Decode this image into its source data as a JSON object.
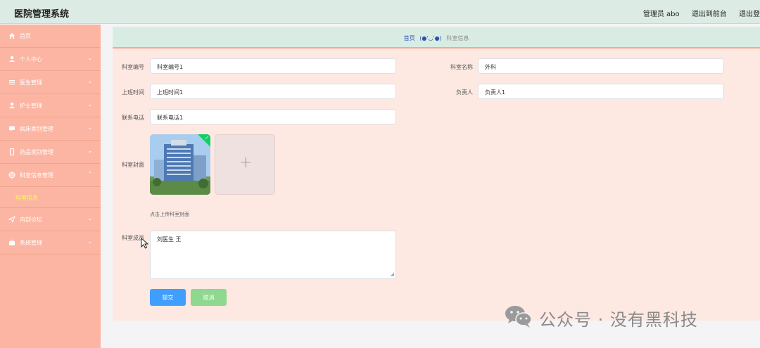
{
  "header": {
    "title": "医院管理系统",
    "admin": "管理员 abo",
    "back_to_front": "退出到前台",
    "logout": "退出登"
  },
  "sidebar": {
    "items": [
      {
        "label": "首页",
        "icon": "home-icon",
        "has_chevron": false
      },
      {
        "label": "个人中心",
        "icon": "user-icon",
        "has_chevron": true
      },
      {
        "label": "医生管理",
        "icon": "list-icon",
        "has_chevron": true
      },
      {
        "label": "护士管理",
        "icon": "user-icon",
        "has_chevron": true
      },
      {
        "label": "病床类别管理",
        "icon": "chat-icon",
        "has_chevron": true
      },
      {
        "label": "药品类别管理",
        "icon": "phone-icon",
        "has_chevron": true
      },
      {
        "label": "科室信息管理",
        "icon": "globe-icon",
        "has_chevron": true,
        "expanded": true
      }
    ],
    "active_sub": "科室信息",
    "items_after": [
      {
        "label": "内部论坛",
        "icon": "send-icon",
        "has_chevron": true
      },
      {
        "label": "系统管理",
        "icon": "briefcase-icon",
        "has_chevron": true
      }
    ]
  },
  "breadcrumb": {
    "home": "首页",
    "face": "(●'◡'●)",
    "current": "科室信息"
  },
  "form": {
    "dept_no_label": "科室编号",
    "dept_no_value": "科室编号1",
    "dept_name_label": "科室名称",
    "dept_name_value": "外科",
    "work_time_label": "上班时间",
    "work_time_value": "上班时间1",
    "manager_label": "负责人",
    "manager_value": "负责人1",
    "phone_label": "联系电话",
    "phone_value": "联系电话1",
    "cover_label": "科室封面",
    "upload_tip": "点击上传科室封面",
    "members_label": "科室成员",
    "members_value": "刘医生 王",
    "submit": "提交",
    "cancel": "取消"
  },
  "watermark": {
    "text": "公众号 · 没有黑科技"
  },
  "colors": {
    "sidebar": "#fcb5a2",
    "header": "#dcebe3",
    "primary": "#409eff",
    "cancel": "#8fd88f",
    "active_sub": "#f5ff4a"
  }
}
